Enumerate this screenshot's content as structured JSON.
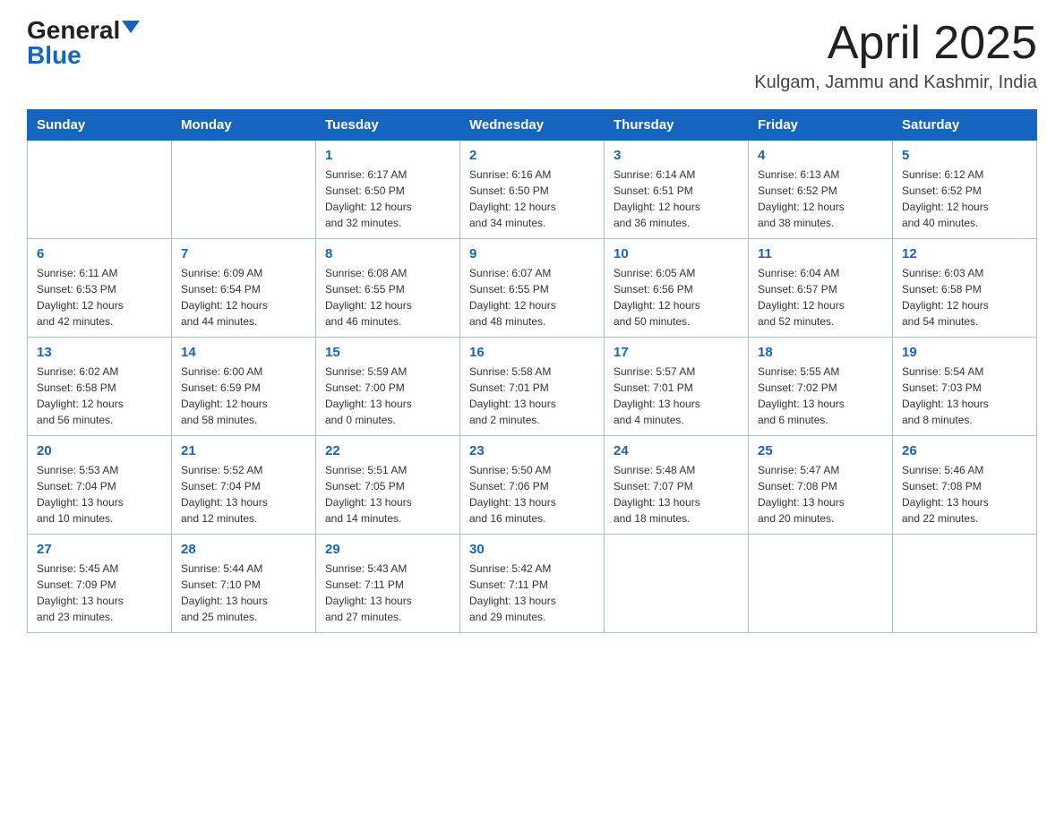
{
  "logo": {
    "text_general": "General",
    "text_blue": "Blue"
  },
  "title": {
    "month_year": "April 2025",
    "location": "Kulgam, Jammu and Kashmir, India"
  },
  "headers": [
    "Sunday",
    "Monday",
    "Tuesday",
    "Wednesday",
    "Thursday",
    "Friday",
    "Saturday"
  ],
  "weeks": [
    [
      {
        "day": "",
        "info": ""
      },
      {
        "day": "",
        "info": ""
      },
      {
        "day": "1",
        "info": "Sunrise: 6:17 AM\nSunset: 6:50 PM\nDaylight: 12 hours\nand 32 minutes."
      },
      {
        "day": "2",
        "info": "Sunrise: 6:16 AM\nSunset: 6:50 PM\nDaylight: 12 hours\nand 34 minutes."
      },
      {
        "day": "3",
        "info": "Sunrise: 6:14 AM\nSunset: 6:51 PM\nDaylight: 12 hours\nand 36 minutes."
      },
      {
        "day": "4",
        "info": "Sunrise: 6:13 AM\nSunset: 6:52 PM\nDaylight: 12 hours\nand 38 minutes."
      },
      {
        "day": "5",
        "info": "Sunrise: 6:12 AM\nSunset: 6:52 PM\nDaylight: 12 hours\nand 40 minutes."
      }
    ],
    [
      {
        "day": "6",
        "info": "Sunrise: 6:11 AM\nSunset: 6:53 PM\nDaylight: 12 hours\nand 42 minutes."
      },
      {
        "day": "7",
        "info": "Sunrise: 6:09 AM\nSunset: 6:54 PM\nDaylight: 12 hours\nand 44 minutes."
      },
      {
        "day": "8",
        "info": "Sunrise: 6:08 AM\nSunset: 6:55 PM\nDaylight: 12 hours\nand 46 minutes."
      },
      {
        "day": "9",
        "info": "Sunrise: 6:07 AM\nSunset: 6:55 PM\nDaylight: 12 hours\nand 48 minutes."
      },
      {
        "day": "10",
        "info": "Sunrise: 6:05 AM\nSunset: 6:56 PM\nDaylight: 12 hours\nand 50 minutes."
      },
      {
        "day": "11",
        "info": "Sunrise: 6:04 AM\nSunset: 6:57 PM\nDaylight: 12 hours\nand 52 minutes."
      },
      {
        "day": "12",
        "info": "Sunrise: 6:03 AM\nSunset: 6:58 PM\nDaylight: 12 hours\nand 54 minutes."
      }
    ],
    [
      {
        "day": "13",
        "info": "Sunrise: 6:02 AM\nSunset: 6:58 PM\nDaylight: 12 hours\nand 56 minutes."
      },
      {
        "day": "14",
        "info": "Sunrise: 6:00 AM\nSunset: 6:59 PM\nDaylight: 12 hours\nand 58 minutes."
      },
      {
        "day": "15",
        "info": "Sunrise: 5:59 AM\nSunset: 7:00 PM\nDaylight: 13 hours\nand 0 minutes."
      },
      {
        "day": "16",
        "info": "Sunrise: 5:58 AM\nSunset: 7:01 PM\nDaylight: 13 hours\nand 2 minutes."
      },
      {
        "day": "17",
        "info": "Sunrise: 5:57 AM\nSunset: 7:01 PM\nDaylight: 13 hours\nand 4 minutes."
      },
      {
        "day": "18",
        "info": "Sunrise: 5:55 AM\nSunset: 7:02 PM\nDaylight: 13 hours\nand 6 minutes."
      },
      {
        "day": "19",
        "info": "Sunrise: 5:54 AM\nSunset: 7:03 PM\nDaylight: 13 hours\nand 8 minutes."
      }
    ],
    [
      {
        "day": "20",
        "info": "Sunrise: 5:53 AM\nSunset: 7:04 PM\nDaylight: 13 hours\nand 10 minutes."
      },
      {
        "day": "21",
        "info": "Sunrise: 5:52 AM\nSunset: 7:04 PM\nDaylight: 13 hours\nand 12 minutes."
      },
      {
        "day": "22",
        "info": "Sunrise: 5:51 AM\nSunset: 7:05 PM\nDaylight: 13 hours\nand 14 minutes."
      },
      {
        "day": "23",
        "info": "Sunrise: 5:50 AM\nSunset: 7:06 PM\nDaylight: 13 hours\nand 16 minutes."
      },
      {
        "day": "24",
        "info": "Sunrise: 5:48 AM\nSunset: 7:07 PM\nDaylight: 13 hours\nand 18 minutes."
      },
      {
        "day": "25",
        "info": "Sunrise: 5:47 AM\nSunset: 7:08 PM\nDaylight: 13 hours\nand 20 minutes."
      },
      {
        "day": "26",
        "info": "Sunrise: 5:46 AM\nSunset: 7:08 PM\nDaylight: 13 hours\nand 22 minutes."
      }
    ],
    [
      {
        "day": "27",
        "info": "Sunrise: 5:45 AM\nSunset: 7:09 PM\nDaylight: 13 hours\nand 23 minutes."
      },
      {
        "day": "28",
        "info": "Sunrise: 5:44 AM\nSunset: 7:10 PM\nDaylight: 13 hours\nand 25 minutes."
      },
      {
        "day": "29",
        "info": "Sunrise: 5:43 AM\nSunset: 7:11 PM\nDaylight: 13 hours\nand 27 minutes."
      },
      {
        "day": "30",
        "info": "Sunrise: 5:42 AM\nSunset: 7:11 PM\nDaylight: 13 hours\nand 29 minutes."
      },
      {
        "day": "",
        "info": ""
      },
      {
        "day": "",
        "info": ""
      },
      {
        "day": "",
        "info": ""
      }
    ]
  ]
}
